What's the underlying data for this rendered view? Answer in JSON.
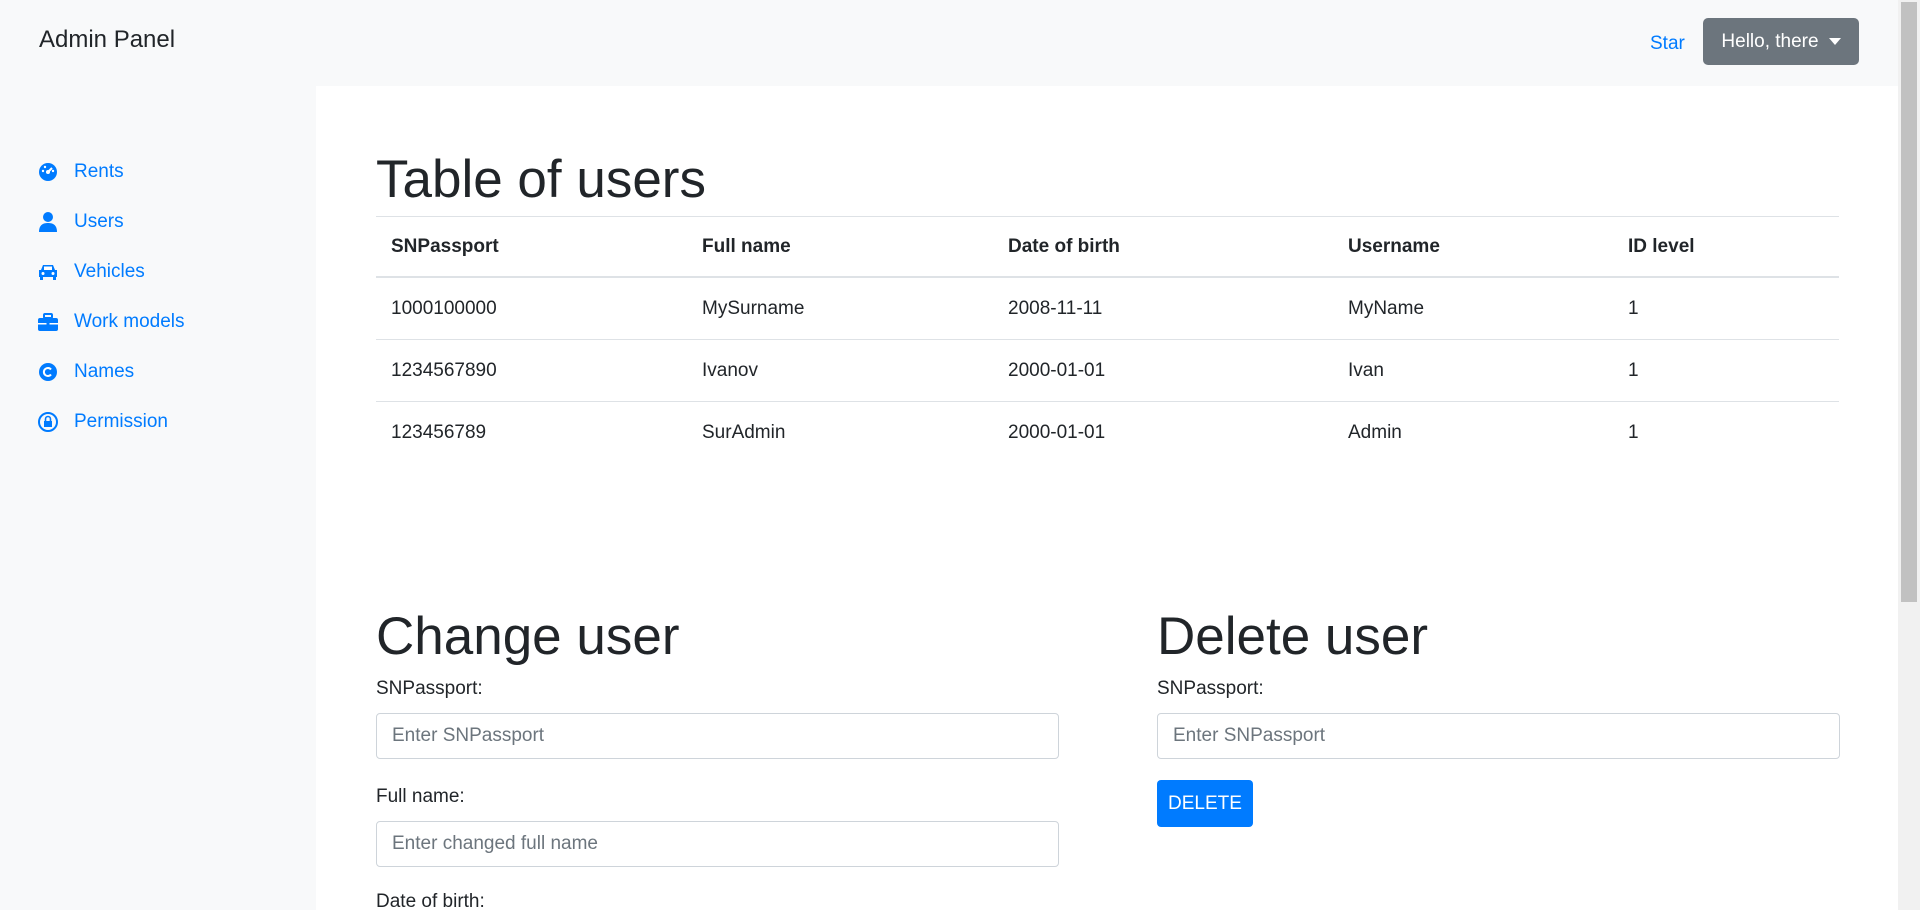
{
  "header": {
    "brand": "Admin Panel",
    "star_link": "Star",
    "user_menu_label": "Hello, there"
  },
  "sidebar": {
    "items": [
      {
        "label": "Rents",
        "icon": "tachometer-icon"
      },
      {
        "label": "Users",
        "icon": "user-icon"
      },
      {
        "label": "Vehicles",
        "icon": "car-icon"
      },
      {
        "label": "Work models",
        "icon": "briefcase-icon"
      },
      {
        "label": "Names",
        "icon": "copyright-icon"
      },
      {
        "label": "Permission",
        "icon": "lock-icon"
      }
    ]
  },
  "users_section": {
    "title": "Table of users",
    "columns": [
      "SNPassport",
      "Full name",
      "Date of birth",
      "Username",
      "ID level"
    ],
    "rows": [
      [
        "1000100000",
        "MySurname",
        "2008-11-11",
        "MyName",
        "1"
      ],
      [
        "1234567890",
        "Ivanov",
        "2000-01-01",
        "Ivan",
        "1"
      ],
      [
        "123456789",
        "SurAdmin",
        "2000-01-01",
        "Admin",
        "1"
      ]
    ]
  },
  "change_user": {
    "title": "Change user",
    "snpassport_label": "SNPassport:",
    "snpassport_placeholder": "Enter SNPassport",
    "fullname_label": "Full name:",
    "fullname_placeholder": "Enter changed full name",
    "dob_label": "Date of birth:"
  },
  "delete_user": {
    "title": "Delete user",
    "snpassport_label": "SNPassport:",
    "snpassport_placeholder": "Enter SNPassport",
    "delete_button": "DELETE"
  },
  "colors": {
    "link": "#007bff",
    "secondary_button": "#6c757d",
    "primary_button": "#007bff",
    "background": "#f8f9fa"
  }
}
